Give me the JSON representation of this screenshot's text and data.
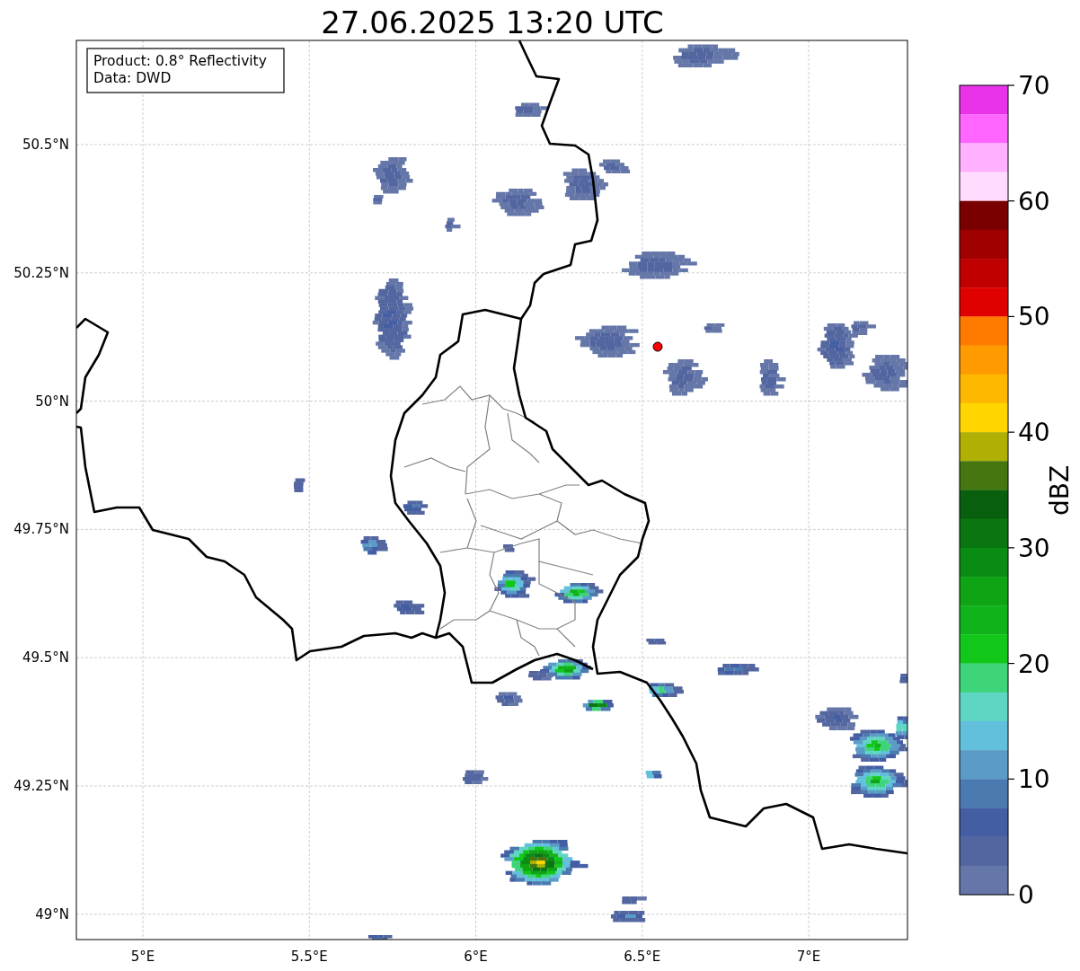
{
  "title": "27.06.2025 13:20 UTC",
  "info_box": {
    "lines": [
      "Product: 0.8° Reflectivity",
      "Data: DWD"
    ]
  },
  "map": {
    "lat_labels": [
      "50.5°N",
      "50.25°N",
      "50°N",
      "49.75°N",
      "49.5°N",
      "49.25°N",
      "49°N"
    ],
    "lon_labels": [
      "5°E",
      "5.5°E",
      "6°E",
      "6.5°E",
      "7°E"
    ]
  },
  "colorbar": {
    "label": "dBZ",
    "tick_labels": [
      "70",
      "60",
      "50",
      "40",
      "30",
      "20",
      "10",
      "0"
    ],
    "bins": [
      {
        "color": "#e833e8"
      },
      {
        "color": "#ff66ff"
      },
      {
        "color": "#ffb0ff"
      },
      {
        "color": "#ffdcff"
      },
      {
        "color": "#7a0000"
      },
      {
        "color": "#a00000"
      },
      {
        "color": "#c00000"
      },
      {
        "color": "#e00000"
      },
      {
        "color": "#ff7b00"
      },
      {
        "color": "#ff9b00"
      },
      {
        "color": "#ffb800"
      },
      {
        "color": "#ffd600"
      },
      {
        "color": "#b0b004"
      },
      {
        "color": "#457610"
      },
      {
        "color": "#08600e"
      },
      {
        "color": "#0a7612"
      },
      {
        "color": "#0a8c14"
      },
      {
        "color": "#0ea414"
      },
      {
        "color": "#10b31a"
      },
      {
        "color": "#11c81a"
      },
      {
        "color": "#3ed47a"
      },
      {
        "color": "#5fd6c4"
      },
      {
        "color": "#63c0dd"
      },
      {
        "color": "#5a9cc7"
      },
      {
        "color": "#4a7ab0"
      },
      {
        "color": "#445ea3"
      },
      {
        "color": "#5366a0"
      },
      {
        "color": "#6577a8"
      }
    ]
  }
}
